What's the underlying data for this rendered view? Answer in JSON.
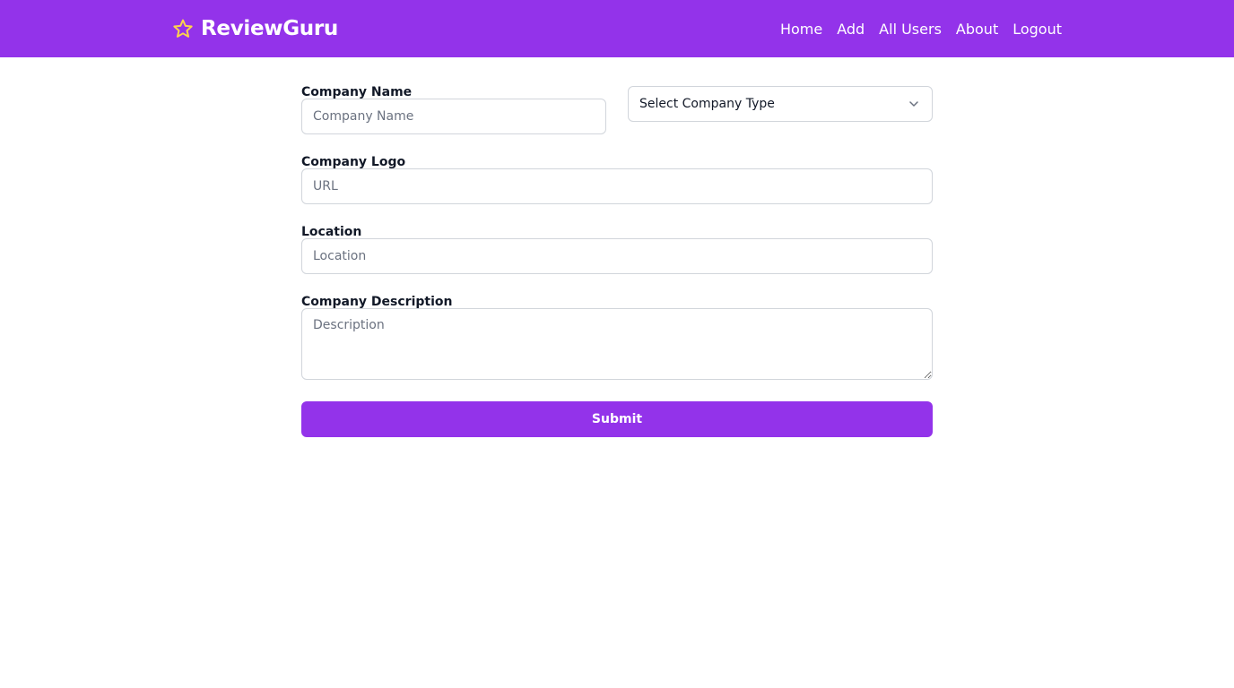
{
  "brand": {
    "name": "ReviewGuru",
    "icon": "star-icon"
  },
  "nav": {
    "items": [
      {
        "label": "Home"
      },
      {
        "label": "Add"
      },
      {
        "label": "All Users"
      },
      {
        "label": "About"
      },
      {
        "label": "Logout"
      }
    ]
  },
  "form": {
    "company_name": {
      "label": "Company Name",
      "placeholder": "Company Name",
      "value": ""
    },
    "company_type": {
      "selected": "Select Company Type",
      "icon": "chevron-down-icon"
    },
    "company_logo": {
      "label": "Company Logo",
      "placeholder": "URL",
      "value": ""
    },
    "location": {
      "label": "Location",
      "placeholder": "Location",
      "value": ""
    },
    "description": {
      "label": "Company Description",
      "placeholder": "Description",
      "value": ""
    },
    "submit_label": "Submit"
  },
  "colors": {
    "brand_purple": "#9333ea",
    "star_yellow": "#fcd34d",
    "input_border": "#d1d5db",
    "placeholder": "#6b7280"
  }
}
